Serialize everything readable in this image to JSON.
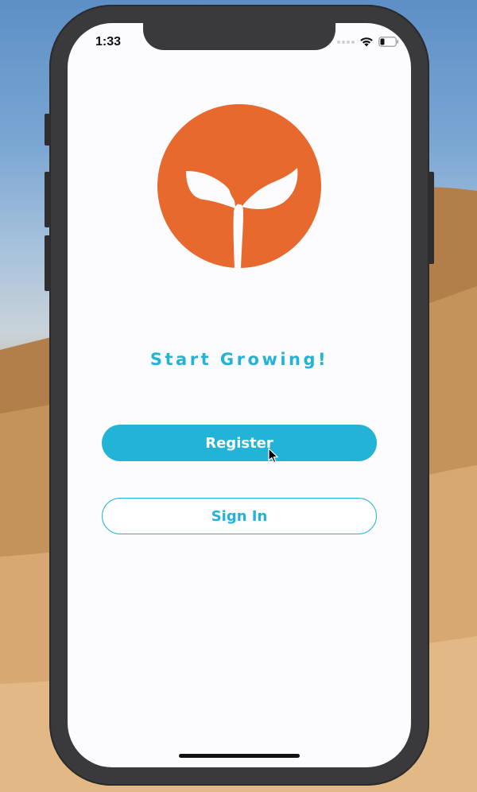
{
  "status_bar": {
    "time": "1:33",
    "wifi_icon": "wifi-icon",
    "battery_icon": "battery-icon"
  },
  "logo": {
    "icon": "sprout-icon",
    "circle_color": "#e8692d"
  },
  "headline": "Start Growing!",
  "buttons": {
    "register_label": "Register",
    "signin_label": "Sign In"
  },
  "colors": {
    "accent": "#23b3d6",
    "brand_orange": "#e8692d",
    "screen_bg": "#fcfbfe"
  }
}
